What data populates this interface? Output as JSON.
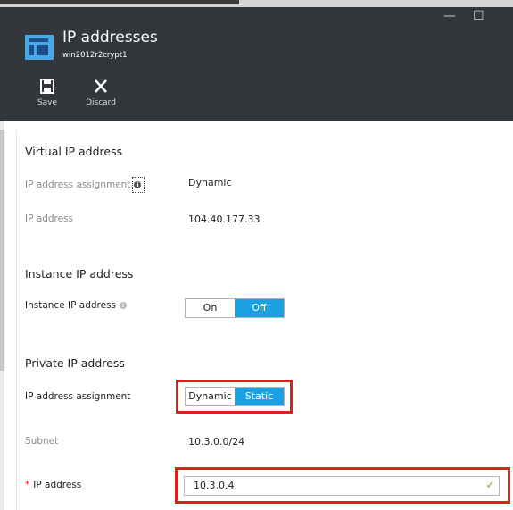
{
  "header": {
    "title": "IP addresses",
    "subtitle": "win2012r2crypt1",
    "icon": "blade-icon",
    "commands": [
      {
        "label": "Save",
        "icon": "save-icon"
      },
      {
        "label": "Discard",
        "icon": "discard-icon"
      }
    ],
    "window_controls": {
      "minimize": "—",
      "maximize": "☐"
    }
  },
  "virtual_ip": {
    "section_title": "Virtual IP address",
    "assignment_label": "IP address assignment",
    "assignment_value": "Dynamic",
    "ip_label": "IP address",
    "ip_value": "104.40.177.33"
  },
  "instance_ip": {
    "section_title": "Instance IP address",
    "label": "Instance IP address",
    "options": [
      "On",
      "Off"
    ],
    "selected": "Off"
  },
  "private_ip": {
    "section_title": "Private IP address",
    "assignment_label": "IP address assignment",
    "options": [
      "Dynamic",
      "Static"
    ],
    "selected": "Static",
    "subnet_label": "Subnet",
    "subnet_value": "10.3.0.0/24",
    "ip_required_marker": "*",
    "ip_label": "IP address",
    "ip_value": "10.3.0.4"
  },
  "colors": {
    "header_bg": "#33373c",
    "accent": "#1ba1e2",
    "highlight": "#e0201b",
    "valid": "#7cb342"
  }
}
